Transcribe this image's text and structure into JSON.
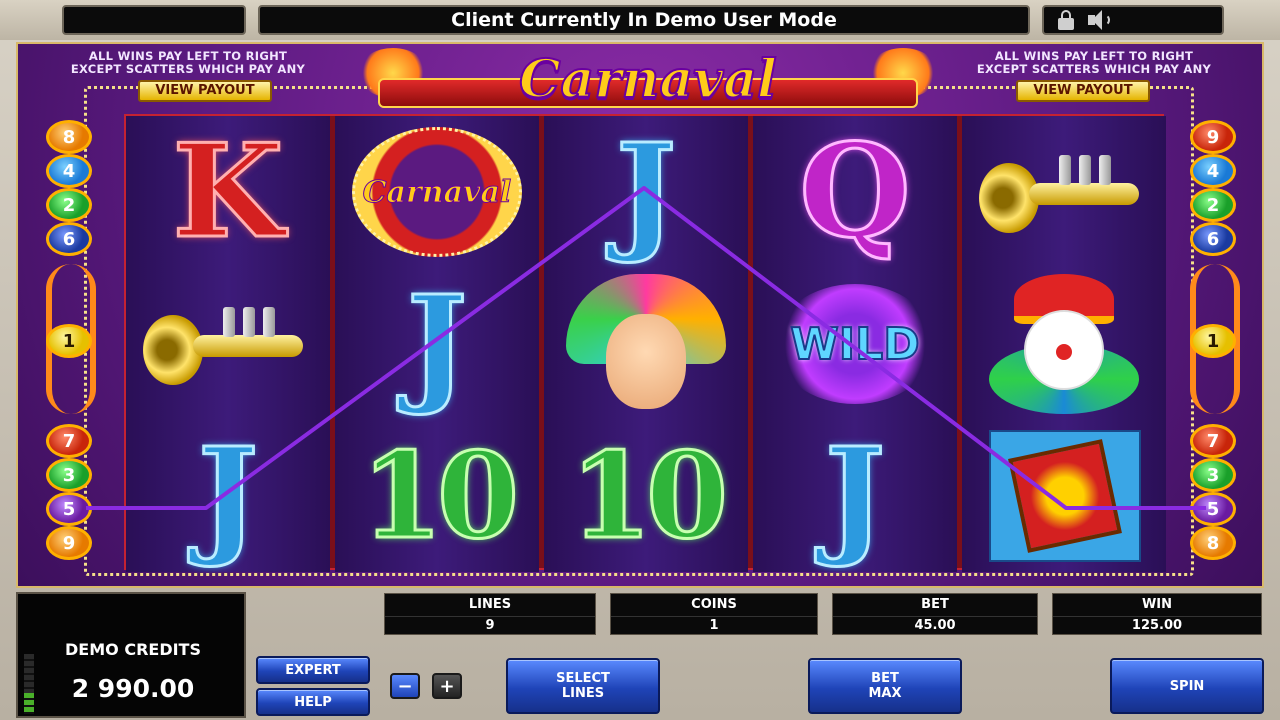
{
  "top_bar": {
    "message": "Client Currently In Demo User Mode",
    "icons": [
      "lock-icon",
      "speaker-icon"
    ]
  },
  "game": {
    "title": "Carnaval",
    "left_note": "ALL WINS PAY LEFT TO RIGHT\nEXCEPT SCATTERS WHICH PAY ANY",
    "right_note": "ALL WINS PAY LEFT TO RIGHT\nEXCEPT SCATTERS WHICH PAY ANY",
    "view_payout_left": "VIEW PAYOUT",
    "view_payout_right": "VIEW PAYOUT",
    "reels": [
      {
        "symbols": [
          "K",
          "trumpet",
          "J"
        ]
      },
      {
        "symbols": [
          "carnaval",
          "J",
          "10"
        ]
      },
      {
        "symbols": [
          "J",
          "dancer",
          "10"
        ]
      },
      {
        "symbols": [
          "Q",
          "wild",
          "J"
        ]
      },
      {
        "symbols": [
          "trumpet",
          "clown",
          "flag"
        ]
      }
    ],
    "wild_text": "WILD",
    "carnaval_symbol_text": "Carnaval",
    "left_numbers": {
      "top": [
        "8",
        "4",
        "2",
        "6"
      ],
      "middle": [
        "1"
      ],
      "bottom": [
        "7",
        "3",
        "5",
        "9"
      ]
    },
    "right_numbers": {
      "top": [
        "9",
        "4",
        "2",
        "6"
      ],
      "middle": [
        "1"
      ],
      "bottom": [
        "7",
        "3",
        "5",
        "8"
      ]
    },
    "active_payline": "5",
    "payline_color": "#8a2be2"
  },
  "panel": {
    "credits_label": "DEMO CREDITS",
    "credits_value": "2 990.00",
    "credits_meter_level": 0.35,
    "lines_label": "LINES",
    "lines_value": "9",
    "coins_label": "COINS",
    "coins_value": "1",
    "bet_label": "BET",
    "bet_value": "45.00",
    "win_label": "WIN",
    "win_value": "125.00",
    "expert_label": "EXPERT",
    "help_label": "HELP",
    "minus_label": "−",
    "plus_label": "+",
    "select_lines_label": "SELECT\nLINES",
    "bet_max_label": "BET\nMAX",
    "spin_label": "SPIN"
  },
  "colors": {
    "frame_purple": "#5b1a80",
    "reel_border_red": "#c52232",
    "button_blue": "#1f44b8",
    "payout_gold": "#e5b400"
  }
}
